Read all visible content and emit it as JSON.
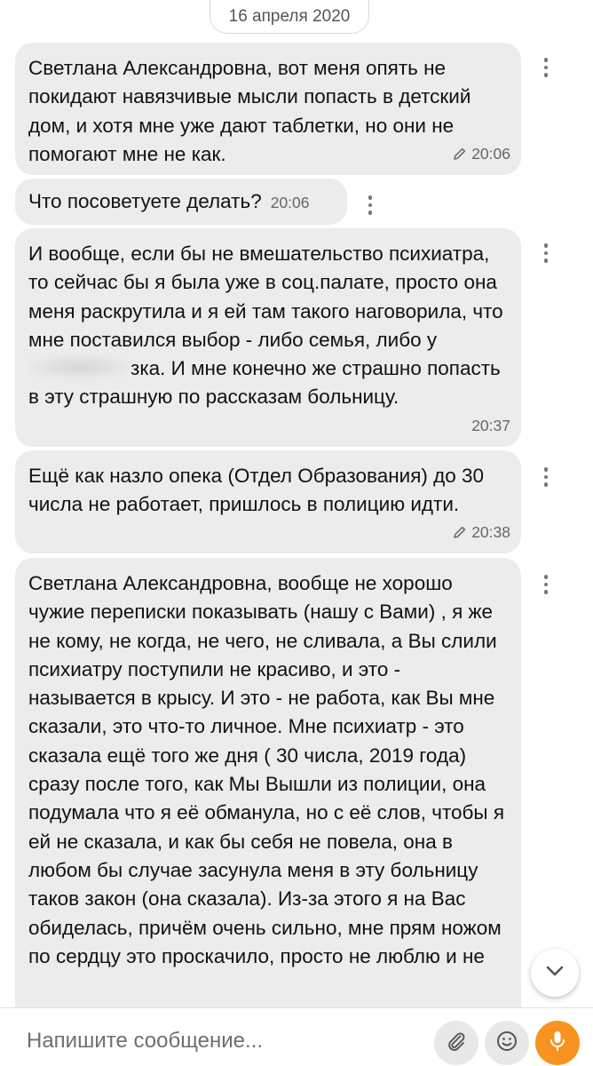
{
  "date_separator": "16 апреля 2020",
  "messages": [
    {
      "text": "Светлана Александровна, вот  меня опять не покидают навязчивые мысли попасть в детский дом, и хотя мне уже дают таблетки, но они не помогают мне не как.",
      "time": "20:06",
      "edited": true
    },
    {
      "text": "Что посоветуете делать?",
      "time": "20:06",
      "edited": false
    },
    {
      "text_before_redaction": "И вообще, если бы не вмешательство психиатра, то сейчас бы я была уже в соц.палате, просто она меня раскрутила и я ей там такого наговорила, что мне поставился выбор - либо семья, либо у",
      "text_after_redaction": "зка. И мне конечно же страшно попасть в эту страшную по рассказам больницу.",
      "time": "20:37",
      "edited": false
    },
    {
      "text": "Ещё как назло опека (Отдел Образования)  до 30 числа не работает, пришлось в полицию идти.",
      "time": "20:38",
      "edited": true
    },
    {
      "text": "Светлана Александровна, вообще не хорошо чужие переписки показывать (нашу с Вами) , я же не кому,  не когда, не чего,  не сливала, а Вы слили психиатру поступили не красиво, и это - называется в крысу. И это - не работа, как Вы мне сказали, это что-то личное. Мне психиатр - это сказала ещё того же дня ( 30 числа, 2019 года) сразу после того, как Мы Вышли из полиции, она подумала что я её обманула, но с её слов, чтобы я ей не сказала, и как бы себя не повела, она в любом бы случае засунула меня в эту больницу таков закон (она сказала). Из-за этого я на Вас обиделась, причём очень сильно, мне прям ножом по сердцу это проскачило, просто не люблю и не"
    }
  ],
  "composer": {
    "placeholder": "Напишите сообщение..."
  },
  "icons": {
    "edited": "pencil-icon",
    "menu": "more-vertical-icon",
    "scroll": "chevron-down-icon",
    "attach": "paperclip-icon",
    "emoji": "smiley-icon",
    "voice": "microphone-icon"
  },
  "colors": {
    "bubble": "#ececec",
    "accent": "#f7931e"
  }
}
